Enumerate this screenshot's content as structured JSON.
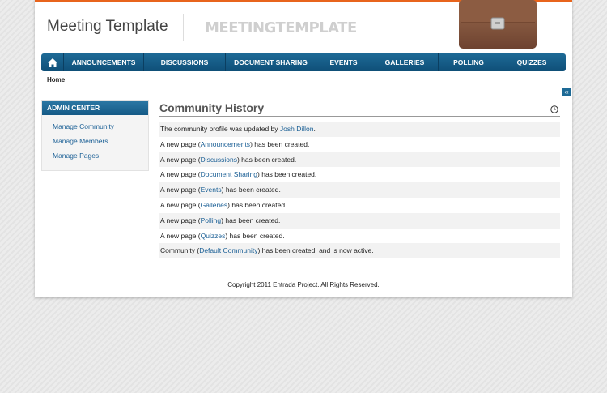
{
  "header": {
    "site_title": "Meeting Template",
    "logo_text": "MEETINGTEMPLATE"
  },
  "nav": {
    "home_icon": "home-icon",
    "items": [
      {
        "label": "ANNOUNCEMENTS"
      },
      {
        "label": "DISCUSSIONS"
      },
      {
        "label": "DOCUMENT SHARING"
      },
      {
        "label": "EVENTS"
      },
      {
        "label": "GALLERIES"
      },
      {
        "label": "POLLING"
      },
      {
        "label": "QUIZZES"
      }
    ]
  },
  "breadcrumb": "Home",
  "collapse_label": "‹‹",
  "sidebar": {
    "header": "ADMIN CENTER",
    "items": [
      {
        "label": "Manage Community"
      },
      {
        "label": "Manage Members"
      },
      {
        "label": "Manage Pages"
      }
    ]
  },
  "main": {
    "title": "Community History",
    "history": [
      {
        "pre": "The community profile was updated by ",
        "link": "Josh Dillon",
        "post": "."
      },
      {
        "pre": "A new page (",
        "link": "Announcements",
        "post": ") has been created."
      },
      {
        "pre": "A new page (",
        "link": "Discussions",
        "post": ") has been created."
      },
      {
        "pre": "A new page (",
        "link": "Document Sharing",
        "post": ") has been created."
      },
      {
        "pre": "A new page (",
        "link": "Events",
        "post": ") has been created."
      },
      {
        "pre": "A new page (",
        "link": "Galleries",
        "post": ") has been created."
      },
      {
        "pre": "A new page (",
        "link": "Polling",
        "post": ") has been created."
      },
      {
        "pre": "A new page (",
        "link": "Quizzes",
        "post": ") has been created."
      },
      {
        "pre": "Community (",
        "link": "Default Community",
        "post": ") has been created, and is now active."
      }
    ]
  },
  "footer": "Copyright 2011 Entrada Project. All Rights Reserved.",
  "colors": {
    "accent": "#e8641c",
    "nav_blue": "#1d6a96",
    "link": "#1a5f95"
  }
}
